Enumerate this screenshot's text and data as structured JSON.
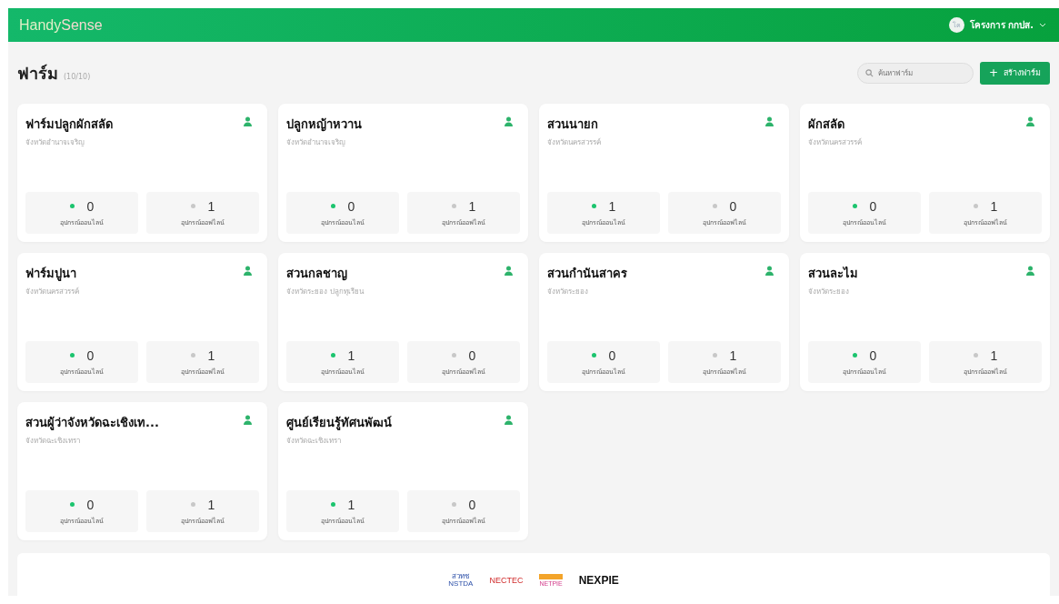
{
  "header": {
    "logo": [
      "Handy",
      "Sense"
    ],
    "user": {
      "initials": "โค",
      "name": "โครงการ กกปส."
    }
  },
  "page": {
    "title": "ฟาร์ม",
    "count": "(10/10)",
    "search": {
      "placeholder": "ค้นหาฟาร์ม"
    },
    "create_button": {
      "icon": "+",
      "label": "สร้างฟาร์ม"
    }
  },
  "farms": [
    {
      "name": "ฟาร์มปลูกผักสลัด",
      "location": "จังหวัดอำนาจเจริญ",
      "stats": [
        {
          "kind": "online",
          "count": "0",
          "label": "อุปกรณ์ออนไลน์"
        },
        {
          "kind": "offline",
          "count": "1",
          "label": "อุปกรณ์ออฟไลน์"
        }
      ]
    },
    {
      "name": "ปลูกหญ้าหวาน",
      "location": "จังหวัดอำนาจเจริญ",
      "stats": [
        {
          "kind": "online",
          "count": "0",
          "label": "อุปกรณ์ออนไลน์"
        },
        {
          "kind": "offline",
          "count": "1",
          "label": "อุปกรณ์ออฟไลน์"
        }
      ]
    },
    {
      "name": "สวนนายก",
      "location": "จังหวัดนครสวรรค์",
      "stats": [
        {
          "kind": "online",
          "count": "1",
          "label": "อุปกรณ์ออนไลน์"
        },
        {
          "kind": "offline",
          "count": "0",
          "label": "อุปกรณ์ออฟไลน์"
        }
      ]
    },
    {
      "name": "ผักสลัด",
      "location": "จังหวัดนครสวรรค์",
      "stats": [
        {
          "kind": "online",
          "count": "0",
          "label": "อุปกรณ์ออนไลน์"
        },
        {
          "kind": "offline",
          "count": "1",
          "label": "อุปกรณ์ออฟไลน์"
        }
      ]
    },
    {
      "name": "ฟาร์มปูนา",
      "location": "จังหวัดนครสวรรค์",
      "stats": [
        {
          "kind": "online",
          "count": "0",
          "label": "อุปกรณ์ออนไลน์"
        },
        {
          "kind": "offline",
          "count": "1",
          "label": "อุปกรณ์ออฟไลน์"
        }
      ]
    },
    {
      "name": "สวนกลชาญ",
      "location": "จังหวัดระยอง ปลูกทุเรียน",
      "stats": [
        {
          "kind": "online",
          "count": "1",
          "label": "อุปกรณ์ออนไลน์"
        },
        {
          "kind": "offline",
          "count": "0",
          "label": "อุปกรณ์ออฟไลน์"
        }
      ]
    },
    {
      "name": "สวนกำนันสาคร",
      "location": "จังหวัดระยอง",
      "stats": [
        {
          "kind": "online",
          "count": "0",
          "label": "อุปกรณ์ออนไลน์"
        },
        {
          "kind": "offline",
          "count": "1",
          "label": "อุปกรณ์ออฟไลน์"
        }
      ]
    },
    {
      "name": "สวนละไม",
      "location": "จังหวัดระยอง",
      "stats": [
        {
          "kind": "online",
          "count": "0",
          "label": "อุปกรณ์ออนไลน์"
        },
        {
          "kind": "offline",
          "count": "1",
          "label": "อุปกรณ์ออฟไลน์"
        }
      ]
    },
    {
      "name": "สวนผู้ว่าจังหวัดฉะเชิงเท...",
      "location": "จังหวัดฉะเชิงเทรา",
      "stats": [
        {
          "kind": "online",
          "count": "0",
          "label": "อุปกรณ์ออนไลน์"
        },
        {
          "kind": "offline",
          "count": "1",
          "label": "อุปกรณ์ออฟไลน์"
        }
      ]
    },
    {
      "name": "ศูนย์เรียนรู้ทัศนพัฒน์",
      "location": "จังหวัดฉะเชิงเทรา",
      "stats": [
        {
          "kind": "online",
          "count": "1",
          "label": "อุปกรณ์ออนไลน์"
        },
        {
          "kind": "offline",
          "count": "0",
          "label": "อุปกรณ์ออฟไลน์"
        }
      ]
    }
  ],
  "footer": {
    "logos": [
      {
        "kind": "nstda",
        "lines": [
          "สวทช",
          "NSTDA"
        ]
      },
      {
        "kind": "nectec",
        "lines": [
          "NECTEC"
        ]
      },
      {
        "kind": "netpie",
        "lines": [
          "NETPIE"
        ]
      },
      {
        "kind": "nexpie",
        "lines": [
          "NEXPIE"
        ]
      }
    ]
  }
}
